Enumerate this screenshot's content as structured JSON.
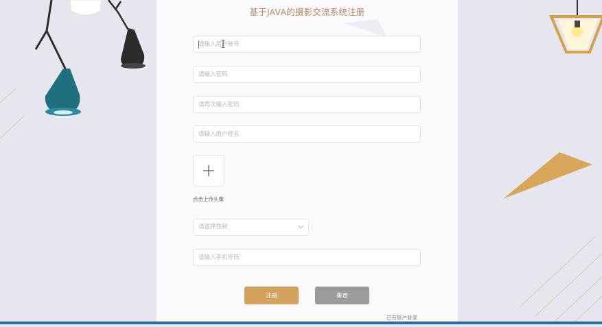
{
  "page": {
    "title": "基于JAVA的摄影交流系统注册"
  },
  "form": {
    "account_placeholder": "请输入用户账号",
    "password_placeholder": "请输入密码",
    "confirm_password_placeholder": "请再次输入密码",
    "name_placeholder": "请输入用户姓名",
    "avatar_label": "点击上传头像",
    "gender_placeholder": "请选择性别",
    "phone_placeholder": "请输入手机号码"
  },
  "actions": {
    "register_label": "注册",
    "reset_label": "重置",
    "login_link": "已有账户登录"
  },
  "colors": {
    "title": "#b08a62",
    "register_button": "#d2a25e",
    "reset_button": "#9b9b9d",
    "background": "#e6e6ef",
    "panel": "#fafafc"
  },
  "icons": {
    "upload": "plus-icon",
    "select": "chevron-down-icon"
  }
}
